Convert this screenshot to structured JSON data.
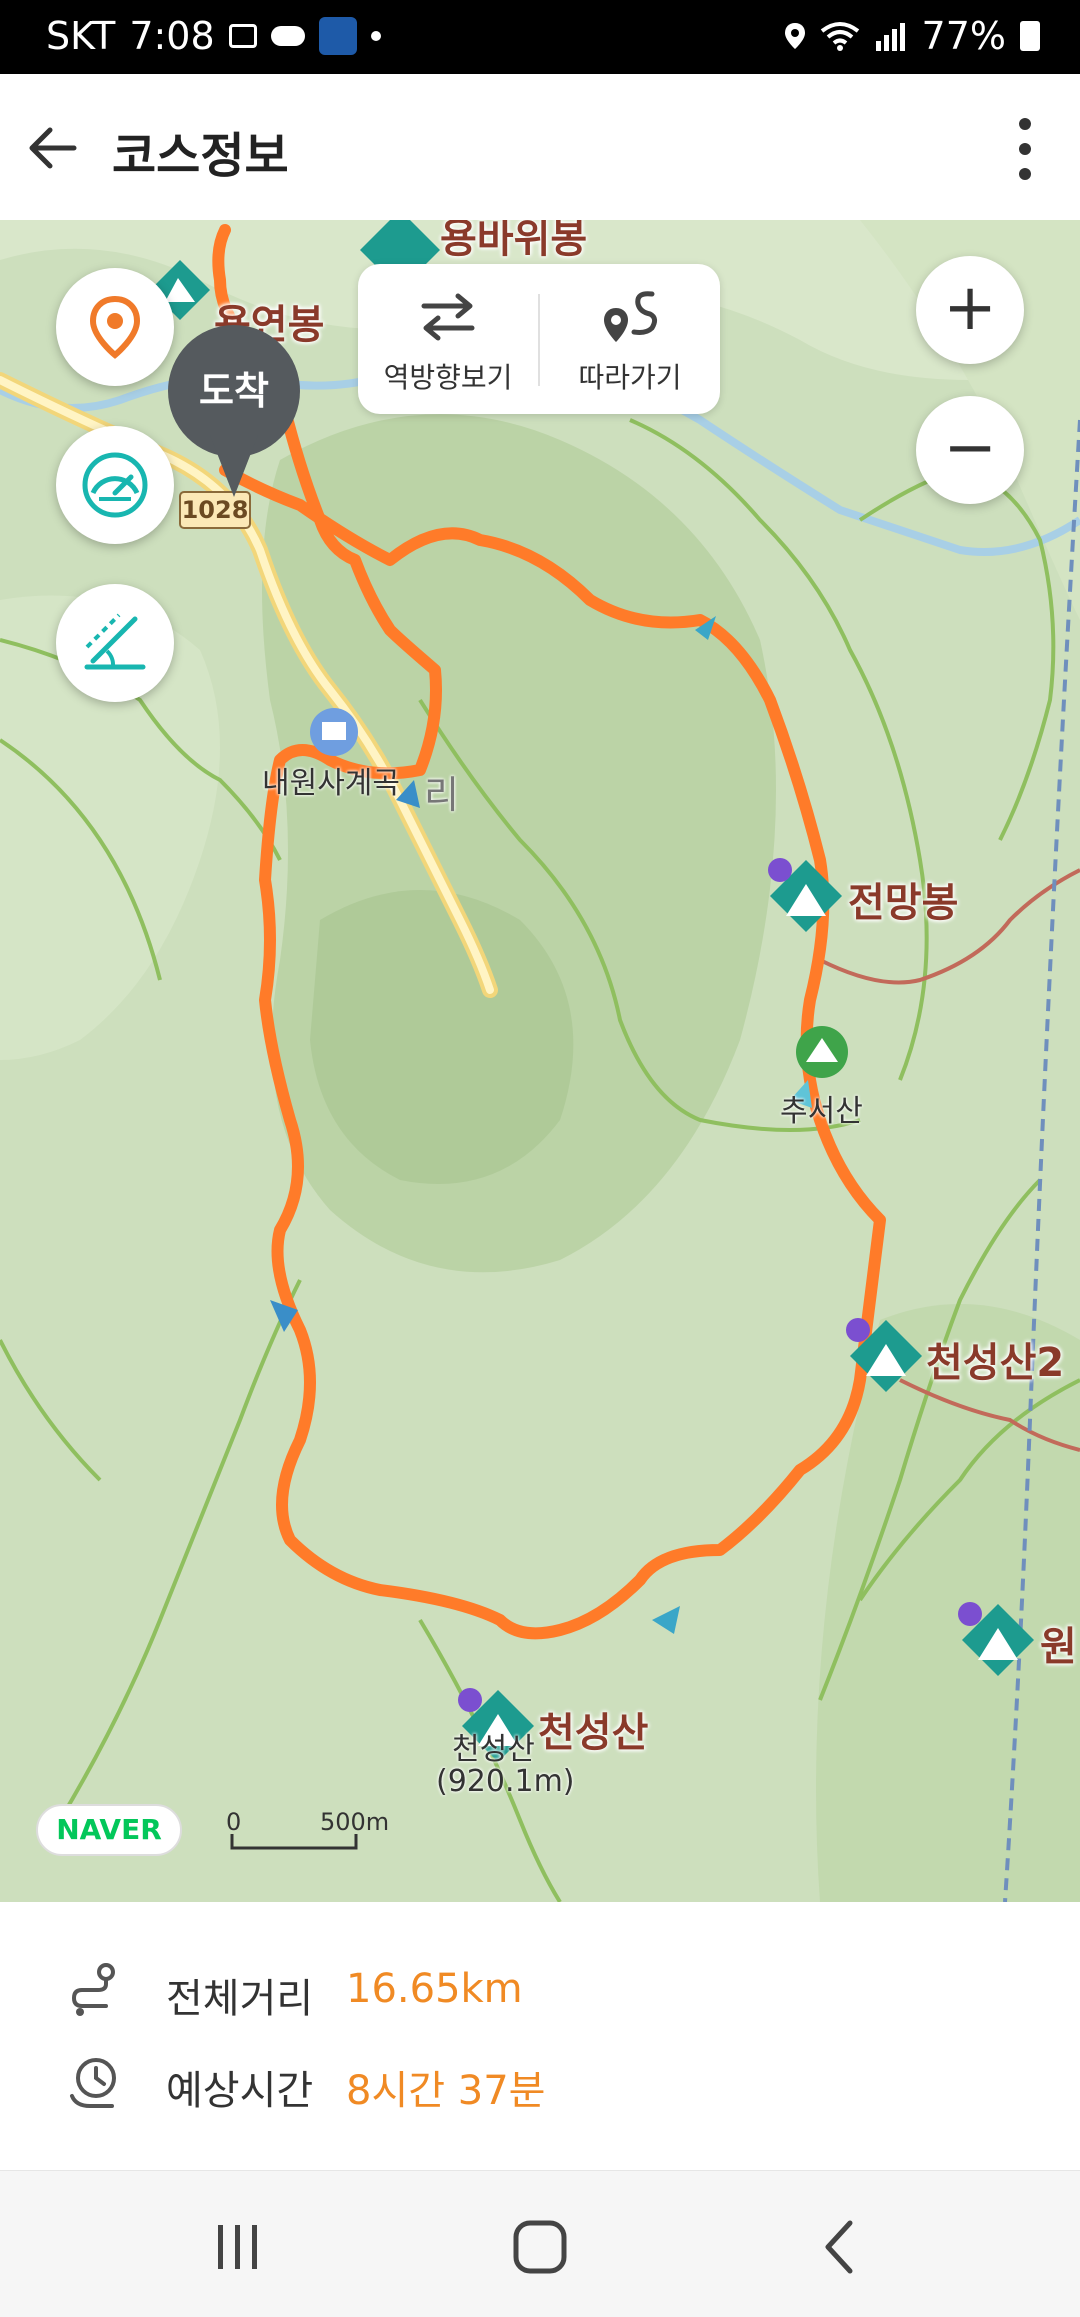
{
  "status_bar": {
    "carrier": "SKT",
    "time": "7:08",
    "battery": "77%"
  },
  "header": {
    "title": "코스정보"
  },
  "map": {
    "view_reverse_label": "역방향보기",
    "follow_label": "따라가기",
    "arrival_label": "도착",
    "route_number": "1028",
    "peaks": [
      {
        "name": "용연봉"
      },
      {
        "name": "전망봉"
      },
      {
        "name": "천성산2"
      },
      {
        "name": "천성산"
      },
      {
        "name": "원"
      },
      {
        "name": "용바위봉"
      }
    ],
    "places": {
      "naewonsa": "내원사계곡",
      "village": "리",
      "chuseo": "추서산",
      "summit_name": "천성산",
      "summit_elev": "(920.1m)"
    },
    "naver_logo": "NAVER",
    "scale_zero": "0",
    "scale_value": "500m",
    "route_color": "#ff7b29"
  },
  "info": {
    "distance_label": "전체거리",
    "distance_value": "16.65km",
    "time_label": "예상시간",
    "time_value": "8시간 37분",
    "accent_color": "#f08a24"
  },
  "icons": {
    "back": "back-arrow-icon",
    "more": "more-vertical-icon",
    "location": "location-pin-icon",
    "speed": "speedometer-icon",
    "slope": "slope-icon",
    "reverse": "swap-arrows-icon",
    "follow": "follow-route-icon",
    "zoom_in": "plus-icon",
    "zoom_out": "minus-icon"
  }
}
